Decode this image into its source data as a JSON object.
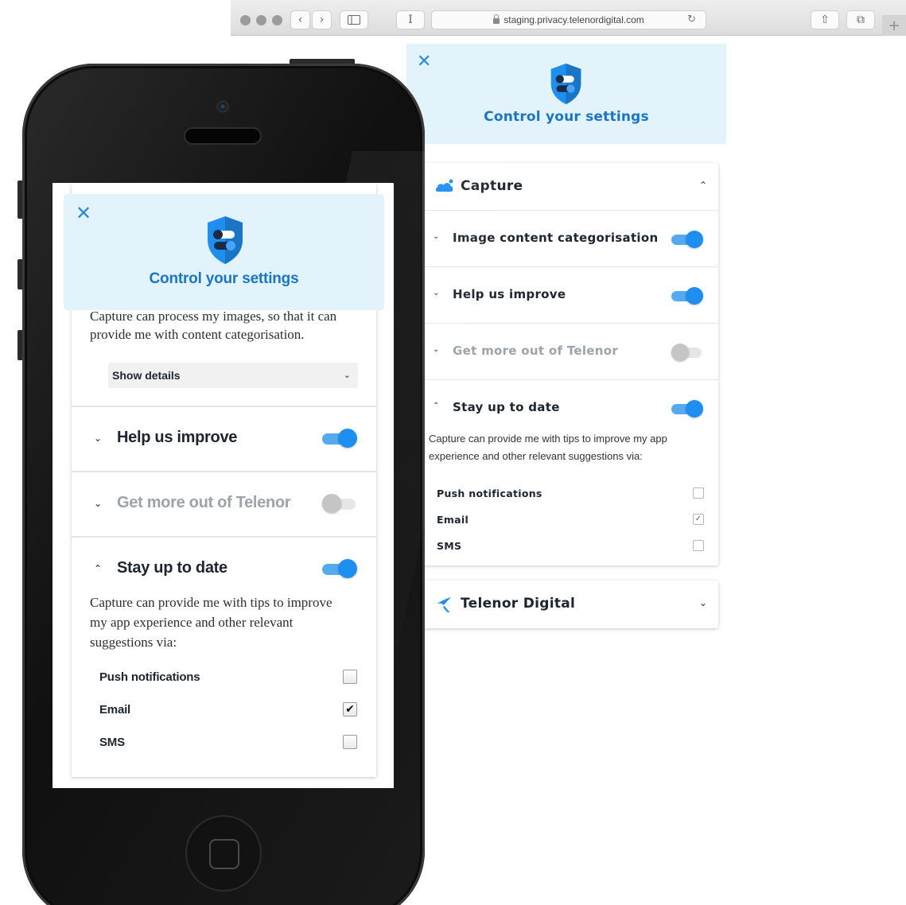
{
  "browser": {
    "url": "staging.privacy.telenordigital.com",
    "back_icon": "‹",
    "forward_icon": "›",
    "reader_icon": "I",
    "reload_icon": "↻",
    "share_icon": "⇧",
    "tabs_icon": "⧉",
    "new_tab_icon": "+"
  },
  "colors": {
    "accent": "#1e8ff0",
    "title_blue": "#1a75c4",
    "header_bg": "#e3f3fc",
    "disabled_text": "#9ba3ab"
  },
  "desktop": {
    "header": {
      "close": "✕",
      "title": "Control your settings"
    },
    "capture_card": {
      "title": "Capture",
      "collapse_chevron": "⌃",
      "rows": [
        {
          "label": "Image content categorisation",
          "chevron": "⌄",
          "enabled": true
        },
        {
          "label": "Help us improve",
          "chevron": "⌄",
          "enabled": true
        },
        {
          "label": "Get more out of Telenor",
          "chevron": "⌄",
          "enabled": false
        }
      ],
      "stay": {
        "label": "Stay up to date",
        "chevron": "⌃",
        "enabled": true,
        "description": "Capture can provide me with tips to improve my app experience and other relevant suggestions via:",
        "options": [
          {
            "label": "Push notifications",
            "checked": false,
            "mark": ""
          },
          {
            "label": "Email",
            "checked": true,
            "mark": "✓"
          },
          {
            "label": "SMS",
            "checked": false,
            "mark": ""
          }
        ]
      }
    },
    "telenor_card": {
      "title": "Telenor Digital",
      "chevron": "⌄"
    }
  },
  "mobile": {
    "header": {
      "close": "✕",
      "title": "Control your settings"
    },
    "image_desc": "Capture can process my images, so that it can provide me with content categorisation.",
    "show_details": {
      "label": "Show details",
      "chevron": "⌄"
    },
    "rows": [
      {
        "label": "Help us improve",
        "chevron": "⌄",
        "enabled": true
      },
      {
        "label": "Get more out of Telenor",
        "chevron": "⌄",
        "enabled": false
      },
      {
        "label": "Stay up to date",
        "chevron": "⌃",
        "enabled": true
      }
    ],
    "stay_description": "Capture can provide me with tips to improve my app experience and other relevant suggestions via:",
    "options": [
      {
        "label": "Push notifications",
        "checked": false,
        "mark": ""
      },
      {
        "label": "Email",
        "checked": true,
        "mark": "✔"
      },
      {
        "label": "SMS",
        "checked": false,
        "mark": ""
      }
    ]
  }
}
